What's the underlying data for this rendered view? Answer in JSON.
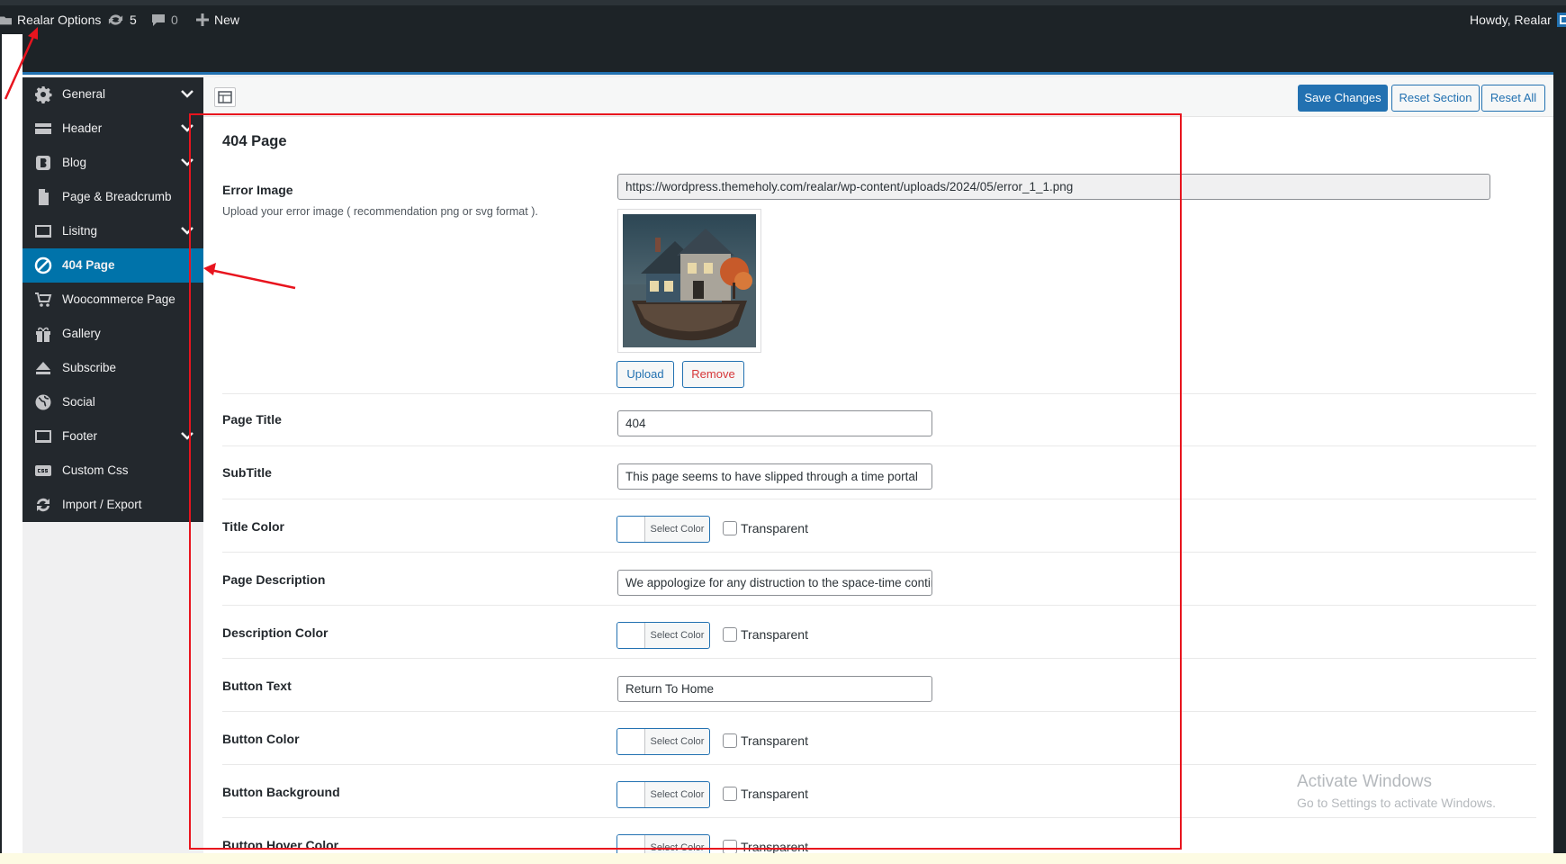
{
  "adminbar": {
    "site_name": "Realar Options",
    "updates_count": "5",
    "comments_count": "0",
    "new_label": "New",
    "howdy": "Howdy, Realar"
  },
  "toolbar": {
    "save_label": "Save Changes",
    "reset_section_label": "Reset Section",
    "reset_all_label": "Reset All"
  },
  "sidebar": {
    "items": [
      {
        "label": "General",
        "icon": "gear-icon"
      },
      {
        "label": "Header",
        "icon": "header-icon"
      },
      {
        "label": "Blog",
        "icon": "blog-icon"
      },
      {
        "label": "Page & Breadcrumb",
        "icon": "page-icon"
      },
      {
        "label": "Lisitng",
        "icon": "listing-icon"
      },
      {
        "label": "404 Page",
        "icon": "block-icon"
      },
      {
        "label": "Woocommerce Page",
        "icon": "cart-icon"
      },
      {
        "label": "Gallery",
        "icon": "gift-icon"
      },
      {
        "label": "Subscribe",
        "icon": "eject-icon"
      },
      {
        "label": "Social",
        "icon": "globe-icon"
      },
      {
        "label": "Footer",
        "icon": "footer-icon"
      },
      {
        "label": "Custom Css",
        "icon": "css-icon"
      },
      {
        "label": "Import / Export",
        "icon": "refresh-icon"
      }
    ]
  },
  "section": {
    "title": "404 Page",
    "error_image": {
      "label": "Error Image",
      "desc": "Upload your error image ( recommendation png or svg format ).",
      "url": "https://wordpress.themeholy.com/realar/wp-content/uploads/2024/05/error_1_1.png",
      "upload_label": "Upload",
      "remove_label": "Remove"
    },
    "page_title": {
      "label": "Page Title",
      "value": "404"
    },
    "subtitle": {
      "label": "SubTitle",
      "value": "This page seems to have slipped through a time portal"
    },
    "title_color": {
      "label": "Title Color"
    },
    "page_description": {
      "label": "Page Description",
      "value": "We appologize for any distruction to the space-time continuum"
    },
    "description_color": {
      "label": "Description Color"
    },
    "button_text": {
      "label": "Button Text",
      "value": "Return To Home"
    },
    "button_color": {
      "label": "Button Color"
    },
    "button_background": {
      "label": "Button Background"
    },
    "button_hover_color": {
      "label": "Button Hover Color"
    }
  },
  "color_picker": {
    "select_label": "Select Color",
    "transparent_label": "Transparent"
  },
  "watermark": {
    "line1": "Activate Windows",
    "line2": "Go to Settings to activate Windows."
  },
  "colors": {
    "accent": "#2271b1",
    "active_menu": "#0073aa",
    "sidebar_bg": "#23282d",
    "annotation_red": "#e8141e"
  }
}
